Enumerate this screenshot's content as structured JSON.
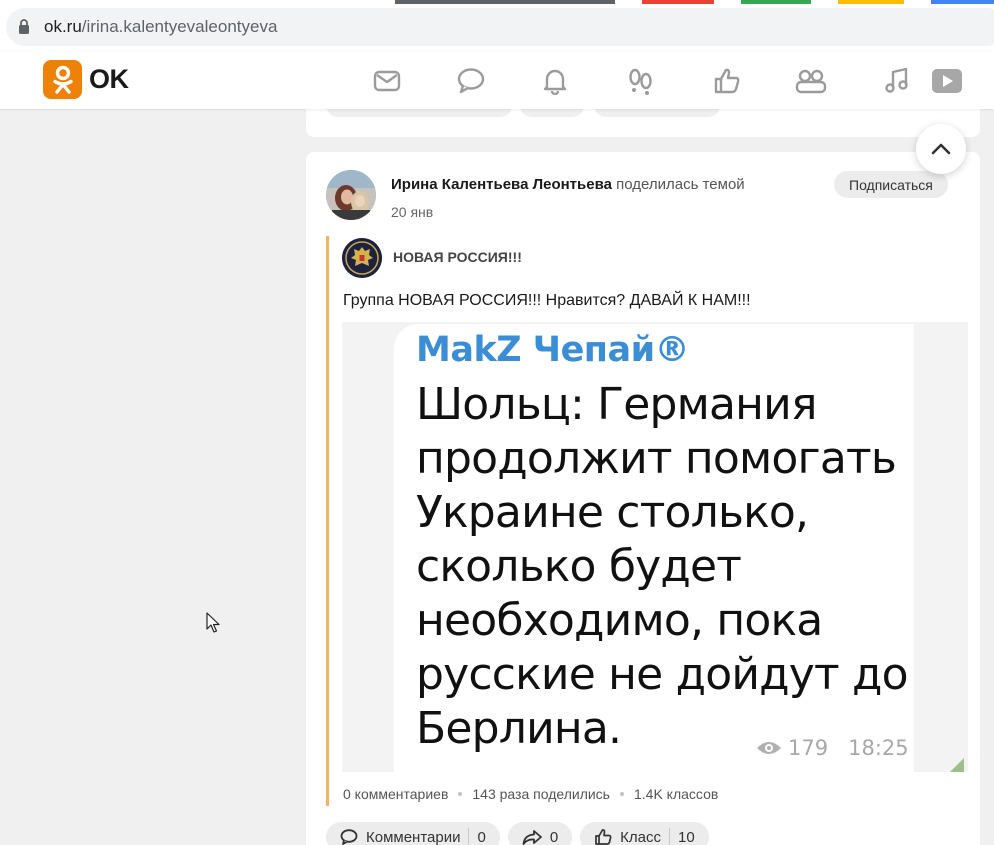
{
  "browser": {
    "url_host": "ok.ru",
    "url_path": "/irina.kalentyevaleontyeva",
    "tab_colors": [
      "#5f6368",
      "#ffffff",
      "#ea4335",
      "#ffffff",
      "#34a853",
      "#ffffff",
      "#fbbc04",
      "#ffffff",
      "#4285f4"
    ]
  },
  "header": {
    "logo_text": "OK",
    "brand_color": "#ee8208",
    "nav": [
      {
        "name": "messages-icon"
      },
      {
        "name": "discussions-icon"
      },
      {
        "name": "notifications-icon"
      },
      {
        "name": "guests-icon"
      },
      {
        "name": "events-icon"
      },
      {
        "name": "friends-icon"
      },
      {
        "name": "music-icon"
      },
      {
        "name": "video-icon"
      }
    ]
  },
  "post": {
    "author": "Ирина Калентьева Леонтьева",
    "action": "поделилась темой",
    "date": "20 янв",
    "subscribe_label": "Подписаться",
    "group_name": "НОВАЯ РОССИЯ!!!",
    "text": "Группа НОВАЯ РОССИЯ!!! Нравится? ДАВАЙ К НАМ!!!",
    "image": {
      "channel": "MakZ Чепай®",
      "lines": [
        "Шольц: Германия",
        "продолжит помогать",
        "Украине столько,",
        "сколько будет",
        "необходимо, пока",
        "русские не дойдут до",
        "Берлина."
      ],
      "views": "179",
      "time": "18:25"
    },
    "stats": {
      "comments": "0 комментариев",
      "shares": "143 раза поделились",
      "likes": "1.4K классов"
    },
    "actions": {
      "comments_label": "Комментарии",
      "comments_count": "0",
      "share_count": "0",
      "like_label": "Класс",
      "like_count": "10"
    }
  }
}
